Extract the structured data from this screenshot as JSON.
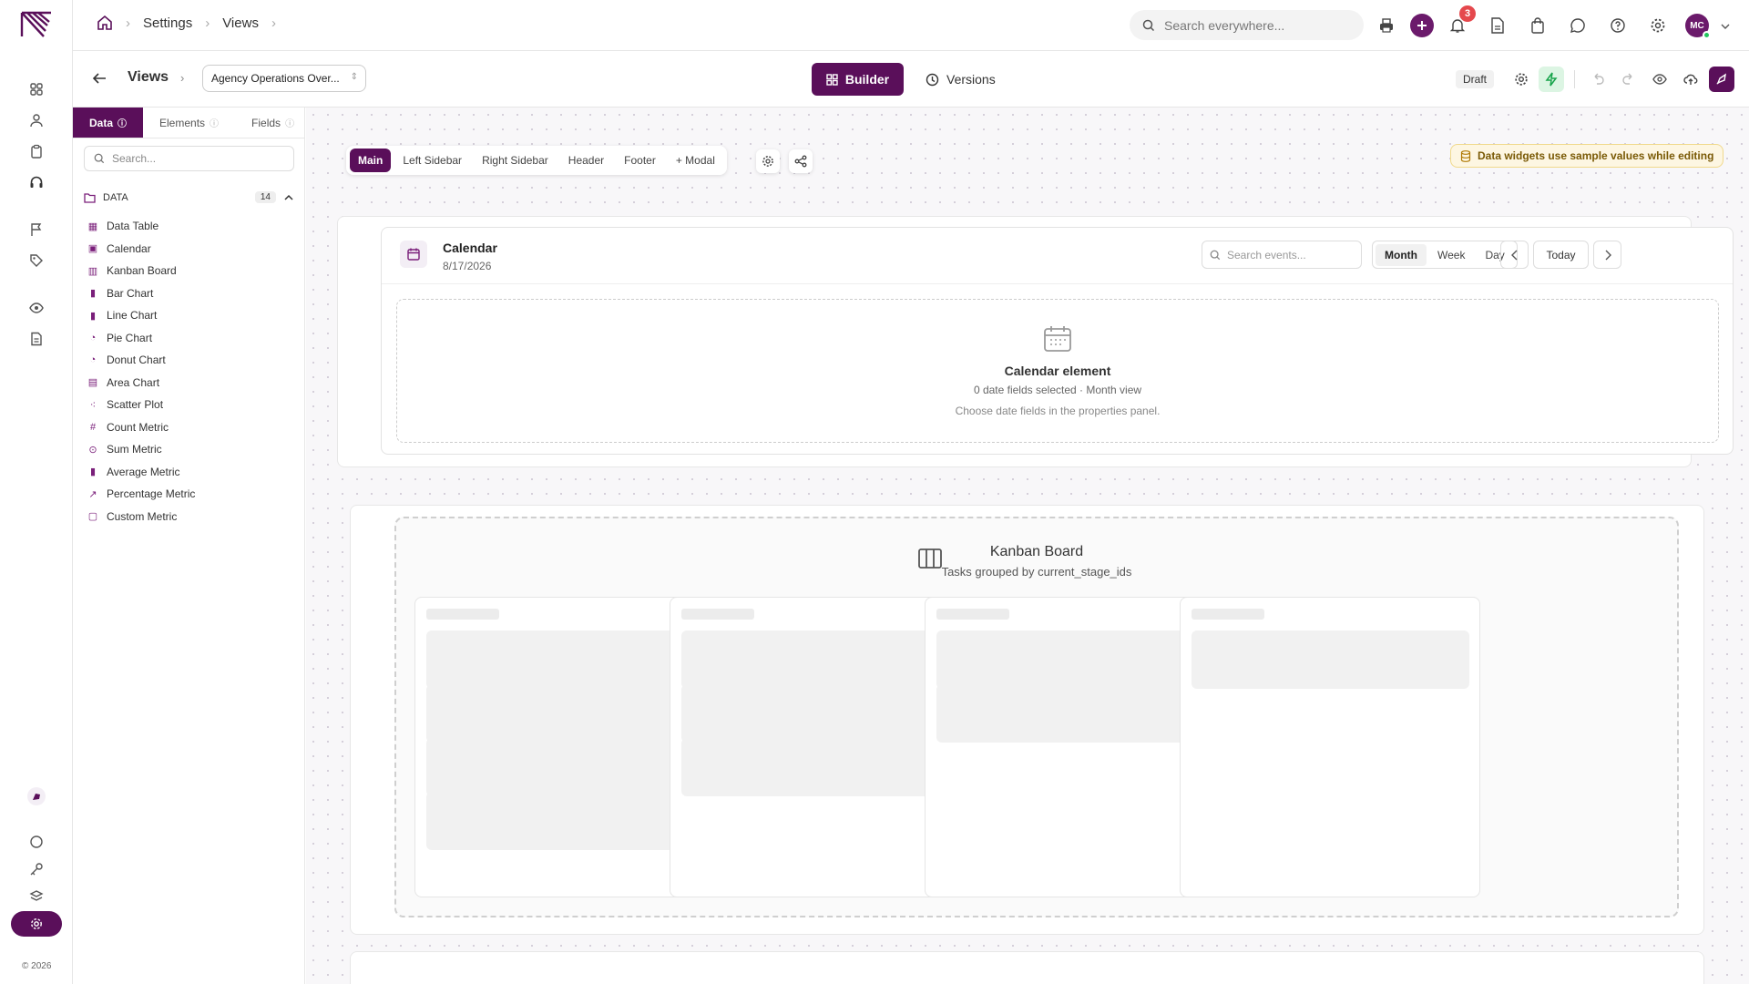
{
  "nav": {
    "copyright": "© 2026"
  },
  "topbar": {
    "breadcrumb": [
      "Settings",
      "Views"
    ],
    "search_placeholder": "Search everywhere...",
    "notifications_count": "3",
    "avatar_initials": "MC"
  },
  "subbar": {
    "title": "Views",
    "view_select": "Agency Operations Over...",
    "builder_label": "Builder",
    "versions_label": "Versions",
    "status": "Draft"
  },
  "panel": {
    "tabs": [
      "Data",
      "Elements",
      "Fields"
    ],
    "search_placeholder": "Search...",
    "section_label": "DATA",
    "section_count": "14",
    "items": [
      {
        "label": "Data Table",
        "icon": "table-icon"
      },
      {
        "label": "Calendar",
        "icon": "calendar-icon"
      },
      {
        "label": "Kanban Board",
        "icon": "kanban-icon"
      },
      {
        "label": "Bar Chart",
        "icon": "bar-chart-icon"
      },
      {
        "label": "Line Chart",
        "icon": "line-chart-icon"
      },
      {
        "label": "Pie Chart",
        "icon": "pie-chart-icon"
      },
      {
        "label": "Donut Chart",
        "icon": "donut-chart-icon"
      },
      {
        "label": "Area Chart",
        "icon": "area-chart-icon"
      },
      {
        "label": "Scatter Plot",
        "icon": "scatter-icon"
      },
      {
        "label": "Count Metric",
        "icon": "hash-icon"
      },
      {
        "label": "Sum Metric",
        "icon": "sum-icon"
      },
      {
        "label": "Average Metric",
        "icon": "average-icon"
      },
      {
        "label": "Percentage Metric",
        "icon": "trend-icon"
      },
      {
        "label": "Custom Metric",
        "icon": "custom-icon"
      }
    ]
  },
  "canvas": {
    "layout_tabs": [
      "Main",
      "Left Sidebar",
      "Right Sidebar",
      "Header",
      "Footer",
      "+ Modal"
    ],
    "notice": "Data widgets use sample values while editing",
    "calendar": {
      "title": "Calendar",
      "date": "8/17/2026",
      "search_placeholder": "Search events...",
      "views": [
        "Month",
        "Week",
        "Day"
      ],
      "today_label": "Today",
      "body_title": "Calendar element",
      "body_sub": "0 date fields selected · Month view",
      "body_hint": "Choose date fields in the properties panel."
    },
    "kanban": {
      "title": "Kanban Board",
      "subtitle": "Tasks grouped by current_stage_ids",
      "columns": [
        4,
        3,
        2,
        1
      ]
    }
  },
  "colors": {
    "brand": "#5a0f5a",
    "notice_bg": "#fdf6e2",
    "badge": "#e5484d",
    "success": "#22c55e"
  }
}
